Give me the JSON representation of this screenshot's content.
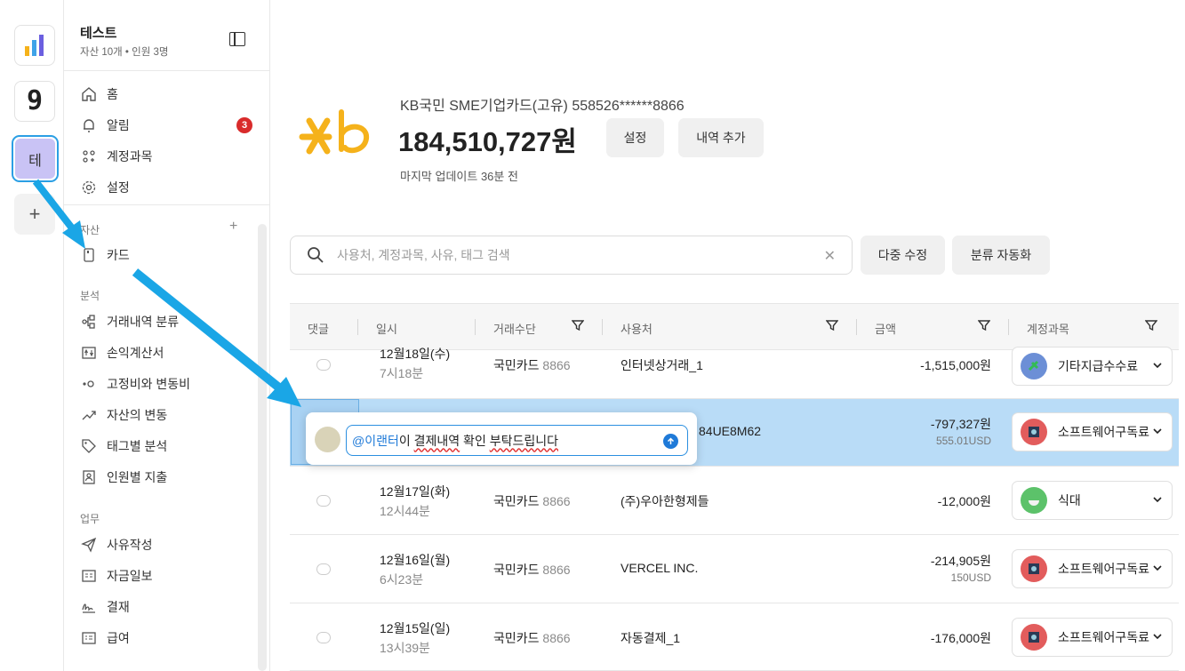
{
  "workspaces": [
    {
      "name": "chart-app",
      "icon": "bar-chart-icon"
    },
    {
      "name": "g-app",
      "glyph": "9"
    },
    {
      "name": "test-workspace",
      "glyph": "테"
    },
    {
      "name": "add",
      "glyph": "+"
    }
  ],
  "org": {
    "title": "테스트",
    "subtitle": "자산 10개 • 인원 3명"
  },
  "nav": {
    "home": "홈",
    "alerts": "알림",
    "alerts_badge": "3",
    "accounts": "계정과목",
    "settings": "설정",
    "assets_header": "자산",
    "assets_add": "+",
    "card": "카드",
    "analysis_header": "분석",
    "tx_classify": "거래내역 분류",
    "pnl": "손익계산서",
    "fixed_variable": "고정비와 변동비",
    "asset_change": "자산의 변동",
    "tag_analysis": "태그별 분석",
    "person_spending": "인원별 지출",
    "work_header": "업무",
    "reason_write": "사유작성",
    "daily_funds": "자금일보",
    "approval": "결재",
    "payroll": "급여"
  },
  "header": {
    "card_name": "KB국민 SME기업카드(고유) 558526******8866",
    "amount": "184,510,727원",
    "settings_btn": "설정",
    "add_btn": "내역 추가",
    "updated": "마지막 업데이트 36분 전"
  },
  "search": {
    "placeholder": "사용처, 계정과목, 사유, 태그 검색",
    "multi_edit": "다중 수정",
    "auto_classify": "분류 자동화"
  },
  "table": {
    "columns": {
      "comment": "댓글",
      "date": "일시",
      "method": "거래수단",
      "merchant": "사용처",
      "amount": "금액",
      "account": "계정과목"
    },
    "rows": [
      {
        "date": "12월18일(수)",
        "time": "7시18분",
        "method": "국민카드",
        "method_num": "8866",
        "merchant": "인터넷상거래_1",
        "amount": "-1,515,000원",
        "usd": "",
        "account": "기타지급수수료",
        "account_color": "#6c8fd6"
      },
      {
        "date": "",
        "time": "",
        "method": "",
        "method_num": "",
        "merchant": "84UE8M62",
        "amount": "-797,327원",
        "usd": "555.01USD",
        "account": "소프트웨어구독료",
        "account_color": "#e25c5c"
      },
      {
        "date": "12월17일(화)",
        "time": "12시44분",
        "method": "국민카드",
        "method_num": "8866",
        "merchant": "(주)우아한형제들",
        "amount": "-12,000원",
        "usd": "",
        "account": "식대",
        "account_color": "#5cc26a"
      },
      {
        "date": "12월16일(월)",
        "time": "6시23분",
        "method": "국민카드",
        "method_num": "8866",
        "merchant": "VERCEL INC.",
        "amount": "-214,905원",
        "usd": "150USD",
        "account": "소프트웨어구독료",
        "account_color": "#e25c5c"
      },
      {
        "date": "12월15일(일)",
        "time": "13시39분",
        "method": "국민카드",
        "method_num": "8866",
        "merchant": "자동결제_1",
        "amount": "-176,000원",
        "usd": "",
        "account": "소프트웨어구독료",
        "account_color": "#e25c5c"
      }
    ]
  },
  "comment_popup": {
    "mention": "@이랜터",
    "text_before": " 이 ",
    "underlined1": "결제내역",
    "mid": " 확인 ",
    "underlined2": "부탁드립니다"
  },
  "colors": {
    "accent": "#1f7ad8",
    "selected_row": "#b9dcf7",
    "badge": "#d92b2b",
    "annotation_arrow": "#1aa6e6",
    "kb_logo": "#f5b21b"
  }
}
